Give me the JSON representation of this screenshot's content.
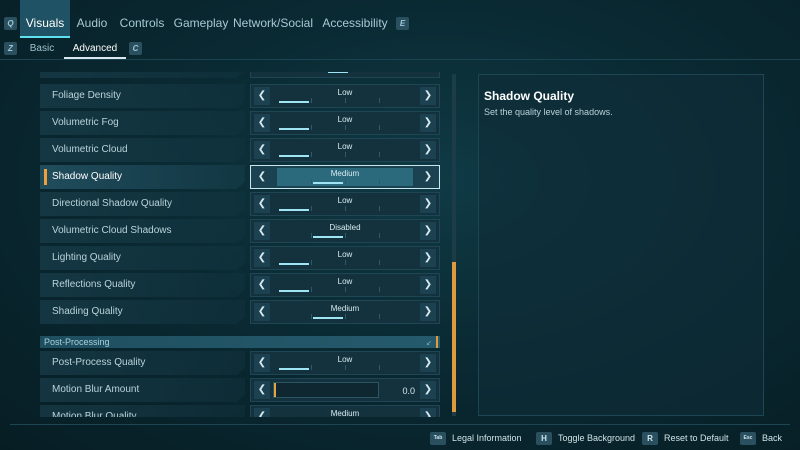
{
  "nav": {
    "left_key": "Q",
    "right_key": "E",
    "tabs": [
      {
        "label": "Visuals",
        "active": true
      },
      {
        "label": "Audio"
      },
      {
        "label": "Controls"
      },
      {
        "label": "Gameplay"
      },
      {
        "label": "Network/Social"
      },
      {
        "label": "Accessibility"
      }
    ]
  },
  "subnav": {
    "left_key": "Z",
    "right_key": "C",
    "tabs": [
      {
        "label": "Basic"
      },
      {
        "label": "Advanced",
        "active": true
      }
    ]
  },
  "settings": [
    {
      "label": "Foliage Density",
      "value": "Low",
      "level": 0.25
    },
    {
      "label": "Volumetric Fog",
      "value": "Low",
      "level": 0.25
    },
    {
      "label": "Volumetric Cloud",
      "value": "Low",
      "level": 0.25
    },
    {
      "label": "Shadow Quality",
      "value": "Medium",
      "level": 0.5,
      "selected": true
    },
    {
      "label": "Directional Shadow Quality",
      "value": "Low",
      "level": 0.25
    },
    {
      "label": "Volumetric Cloud Shadows",
      "value": "Disabled",
      "level": 0.5
    },
    {
      "label": "Lighting Quality",
      "value": "Low",
      "level": 0.25
    },
    {
      "label": "Reflections Quality",
      "value": "Low",
      "level": 0.25
    },
    {
      "label": "Shading Quality",
      "value": "Medium",
      "level": 0.5
    }
  ],
  "section_postprocess": {
    "label": "Post-Processing",
    "icon": "chevron-icon"
  },
  "postprocess_settings": [
    {
      "label": "Post-Process Quality",
      "value": "Low",
      "level": 0.25
    },
    {
      "label": "Motion Blur Amount",
      "value": "0.0",
      "level": 0.0,
      "type": "slider"
    },
    {
      "label": "Motion Blur Quality",
      "value": "Medium",
      "level": 0.5
    }
  ],
  "description": {
    "title": "Shadow Quality",
    "text": "Set the quality level of shadows."
  },
  "footer": {
    "buttons": [
      {
        "key": "Tab",
        "label": "Legal Information"
      },
      {
        "key": "H",
        "label": "Toggle Background"
      },
      {
        "key": "R",
        "label": "Reset to Default"
      },
      {
        "key": "Esc",
        "label": "Back"
      }
    ]
  },
  "colors": {
    "accent": "#5ee0f0",
    "selection": "#f0a03a",
    "background": "#0a2a33"
  }
}
